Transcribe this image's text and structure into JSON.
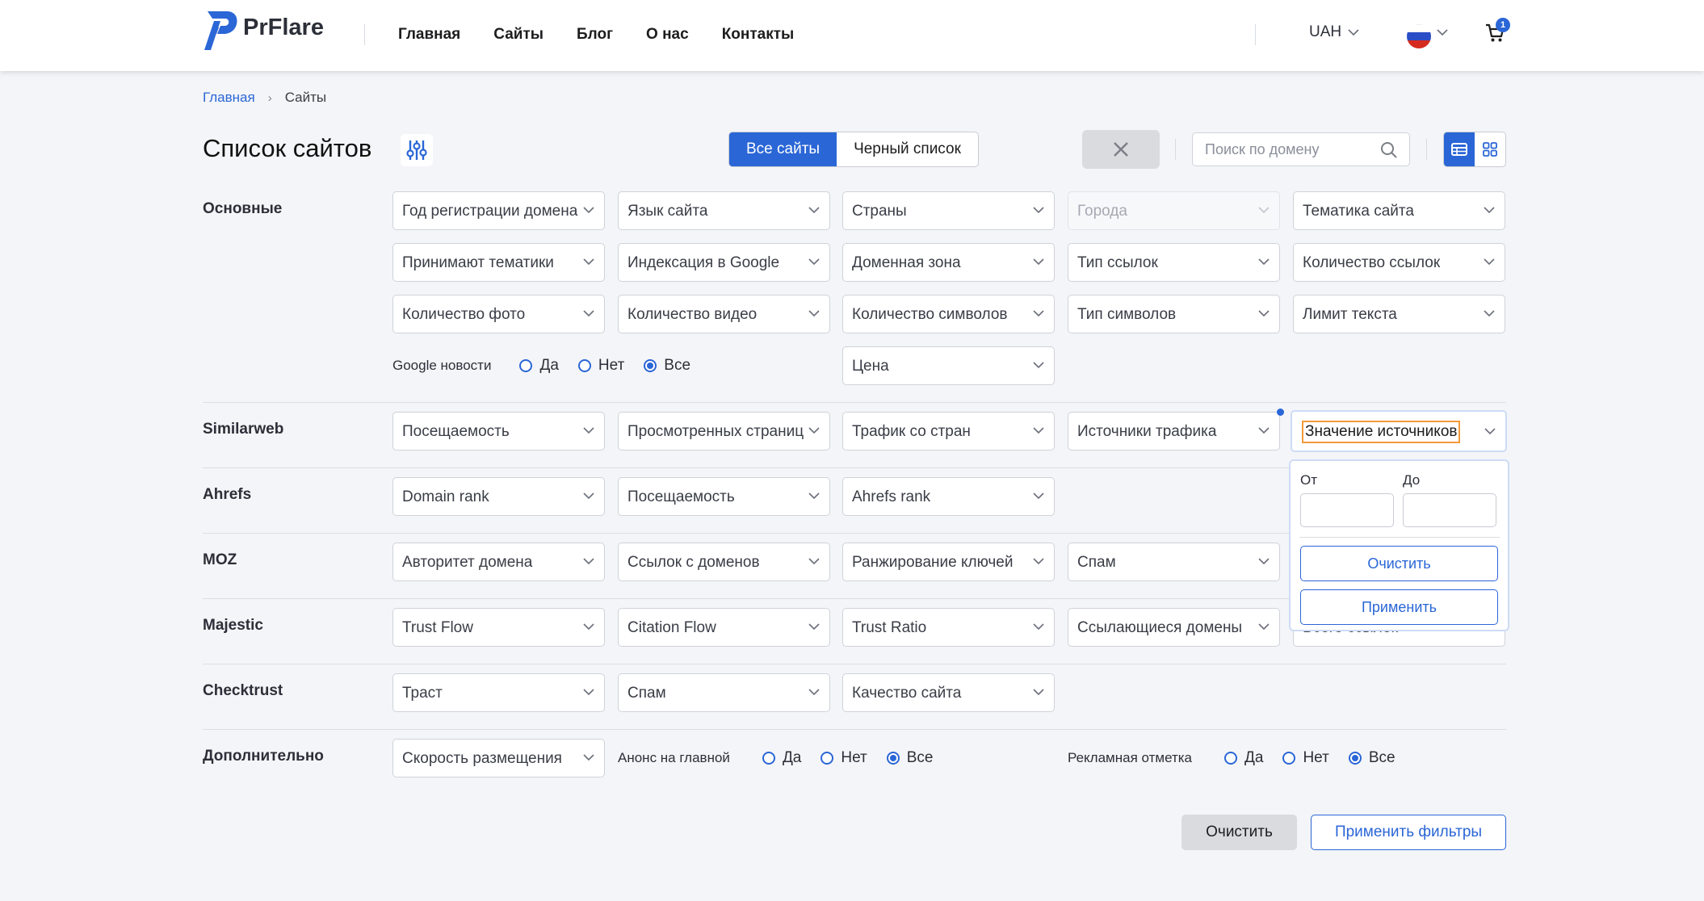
{
  "header": {
    "brand": "PrFlare",
    "nav": [
      "Главная",
      "Сайты",
      "Блог",
      "О нас",
      "Контакты"
    ],
    "currency": "UAH",
    "cart_count": "1"
  },
  "breadcrumb": {
    "home": "Главная",
    "current": "Сайты"
  },
  "toolbar": {
    "title": "Список сайтов",
    "tab_all": "Все сайты",
    "tab_blacklist": "Черный список",
    "search_placeholder": "Поиск по домену"
  },
  "sections": {
    "basic": {
      "label": "Основные",
      "row1": [
        "Год регистрации домена",
        "Язык сайта",
        "Страны",
        "Города",
        "Тематика сайта"
      ],
      "row2": [
        "Принимают тематики",
        "Индексация в Google",
        "Доменная зона",
        "Тип ссылок",
        "Количество ссылок"
      ],
      "row3": [
        "Количество фото",
        "Количество видео",
        "Количество символов",
        "Тип символов",
        "Лимит текста"
      ],
      "google_news": "Google новости",
      "price": "Цена"
    },
    "similarweb": {
      "label": "Similarweb",
      "items": [
        "Посещаемость",
        "Просмотренных страниц",
        "Трафик со стран",
        "Источники трафика",
        "Значение источников"
      ]
    },
    "ahrefs": {
      "label": "Ahrefs",
      "items": [
        "Domain rank",
        "Посещаемость",
        "Ahrefs rank"
      ]
    },
    "moz": {
      "label": "MOZ",
      "items": [
        "Авторитет домена",
        "Ссылок с доменов",
        "Ранжирование ключей",
        "Спам"
      ]
    },
    "majestic": {
      "label": "Majestic",
      "items": [
        "Trust Flow",
        "Citation Flow",
        "Trust Ratio",
        "Ссылающиеся домены",
        "Всего ссылок"
      ]
    },
    "checktrust": {
      "label": "Checktrust",
      "items": [
        "Траст",
        "Спам",
        "Качество сайта"
      ]
    },
    "extra": {
      "label": "Дополнительно",
      "speed": "Скорость размещения",
      "announce": "Анонс на главной",
      "ad_mark": "Рекламная отметка"
    }
  },
  "radio": {
    "yes": "Да",
    "no": "Нет",
    "all": "Все"
  },
  "popover": {
    "from": "От",
    "to": "До",
    "clear": "Очистить",
    "apply": "Применить"
  },
  "footer": {
    "clear": "Очистить",
    "apply": "Применить фильтры"
  },
  "colors": {
    "accent": "#2a66d6",
    "focus": "#f29a3a",
    "bg": "#f4f5f8"
  }
}
